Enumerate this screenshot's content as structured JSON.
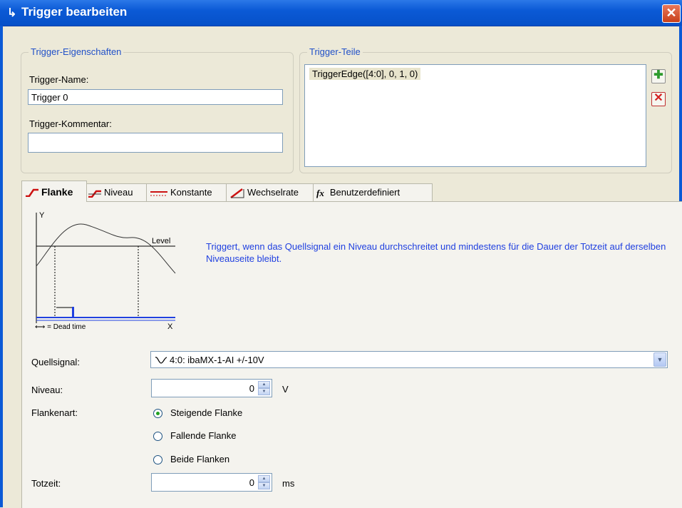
{
  "window": {
    "title": "Trigger bearbeiten",
    "close_glyph": "✕"
  },
  "props": {
    "legend": "Trigger-Eigenschaften",
    "name_label": "Trigger-Name:",
    "name_value": "Trigger 0",
    "comment_label": "Trigger-Kommentar:",
    "comment_value": ""
  },
  "parts": {
    "legend": "Trigger-Teile",
    "items": [
      "TriggerEdge([4:0], 0, 1, 0)"
    ],
    "add_glyph": "✚",
    "delete_glyph": "✕"
  },
  "tabs": [
    {
      "label": "Flanke",
      "active": true
    },
    {
      "label": "Niveau"
    },
    {
      "label": "Konstante"
    },
    {
      "label": "Wechselrate"
    },
    {
      "label": "Benutzerdefiniert"
    }
  ],
  "tab_icons": {
    "fx": "fx"
  },
  "diagram": {
    "y": "Y",
    "x": "X",
    "level": "Level",
    "legend": "⟷ = Dead time"
  },
  "description": "Triggert, wenn das Quellsignal ein Niveau durchschreitet und mindestens für die Dauer der Totzeit auf derselben Niveauseite bleibt.",
  "form": {
    "source_label": "Quellsignal:",
    "source_value": "4:0: ibaMX-1-AI +/-10V",
    "level_label": "Niveau:",
    "level_value": "0",
    "level_unit": "V",
    "edge_label": "Flankenart:",
    "edge_options": [
      "Steigende Flanke",
      "Fallende Flanke",
      "Beide Flanken"
    ],
    "edge_selected": 0,
    "deadtime_label": "Totzeit:",
    "deadtime_value": "0",
    "deadtime_unit": "ms"
  },
  "colors": {
    "title_bar": "#0b5ad6",
    "accent_text": "#2040e0",
    "tab_icon_red": "#cc1111"
  }
}
